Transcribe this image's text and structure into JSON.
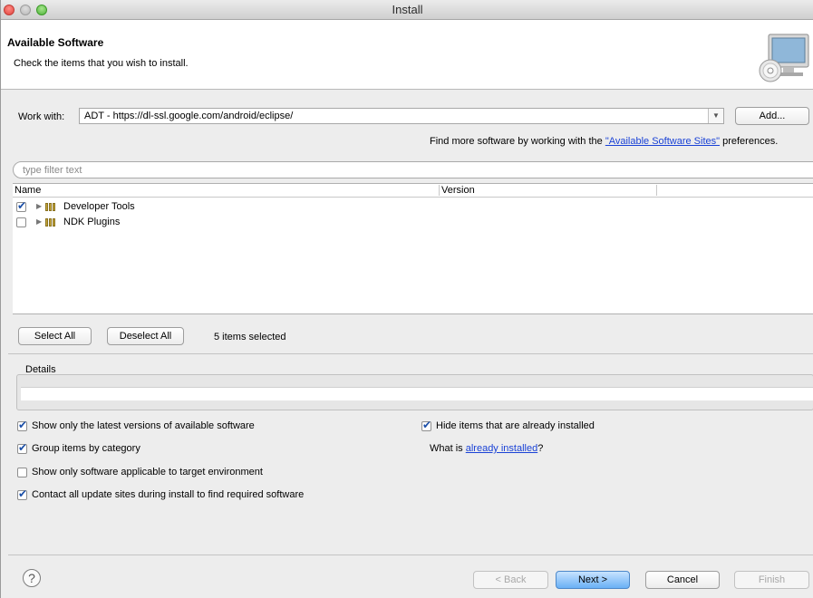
{
  "window": {
    "title": "Install"
  },
  "header": {
    "title": "Available Software",
    "subtitle": "Check the items that you wish to install."
  },
  "work_with": {
    "label": "Work with:",
    "value": "ADT - https://dl-ssl.google.com/android/eclipse/",
    "add_label": "Add..."
  },
  "find_more": {
    "prefix": "Find more software by working with the ",
    "link": "\"Available Software Sites\"",
    "suffix": " preferences."
  },
  "filter": {
    "placeholder": "type filter text"
  },
  "tree": {
    "columns": [
      "Name",
      "Version"
    ],
    "items": [
      {
        "label": "Developer Tools",
        "checked": true
      },
      {
        "label": "NDK Plugins",
        "checked": false
      }
    ]
  },
  "selection": {
    "select_all": "Select All",
    "deselect_all": "Deselect All",
    "count_text": "5 items selected"
  },
  "details": {
    "label": "Details"
  },
  "options": {
    "latest_versions": {
      "label": "Show only the latest versions of available software",
      "checked": true
    },
    "group_by_category": {
      "label": "Group items by category",
      "checked": true
    },
    "target_env": {
      "label": "Show only software applicable to target environment",
      "checked": false
    },
    "contact_sites": {
      "label": "Contact all update sites during install to find required software",
      "checked": true
    },
    "hide_installed": {
      "label": "Hide items that are already installed",
      "checked": true
    },
    "what_is_prefix": "What is ",
    "what_is_link": "already installed",
    "what_is_suffix": "?"
  },
  "footer": {
    "help": "?",
    "back": "< Back",
    "next": "Next >",
    "cancel": "Cancel",
    "finish": "Finish"
  }
}
